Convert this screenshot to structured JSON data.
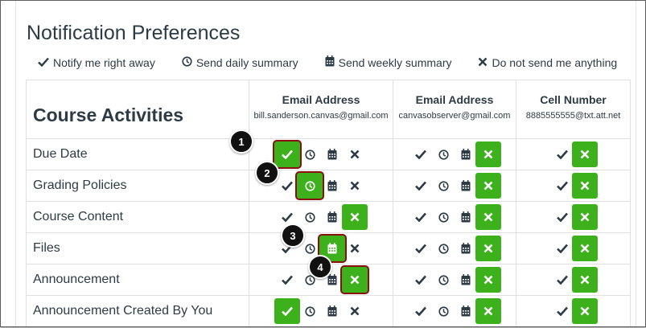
{
  "page_title": "Notification Preferences",
  "legend": [
    {
      "icon": "check-icon",
      "label": "Notify me right away"
    },
    {
      "icon": "clock-icon",
      "label": "Send daily summary"
    },
    {
      "icon": "calendar-icon",
      "label": "Send weekly summary"
    },
    {
      "icon": "x-icon",
      "label": "Do not send me anything"
    }
  ],
  "table": {
    "section_title": "Course Activities",
    "channels": [
      {
        "name": "Email Address",
        "address": "bill.sanderson.canvas@gmail.com"
      },
      {
        "name": "Email Address",
        "address": "canvasobserver@gmail.com"
      },
      {
        "name": "Cell Number",
        "address": "8885555555@txt.att.net"
      }
    ],
    "rows": [
      {
        "label": "Due Date"
      },
      {
        "label": "Grading Policies"
      },
      {
        "label": "Course Content"
      },
      {
        "label": "Files"
      },
      {
        "label": "Announcement"
      },
      {
        "label": "Announcement Created By You"
      }
    ]
  },
  "selections": {
    "channel_1": [
      "right_away",
      "daily",
      "never",
      "weekly",
      "never",
      "right_away"
    ],
    "channel_2": [
      "never",
      "never",
      "never",
      "never",
      "never",
      "never"
    ],
    "channel_3": [
      "never",
      "never",
      "never",
      "never",
      "never",
      "never"
    ]
  },
  "callouts": [
    "1",
    "2",
    "3",
    "4"
  ],
  "colors": {
    "selected": "#3cb11b",
    "highlight_border": "#8b0f0f",
    "text": "#2d3b45"
  }
}
